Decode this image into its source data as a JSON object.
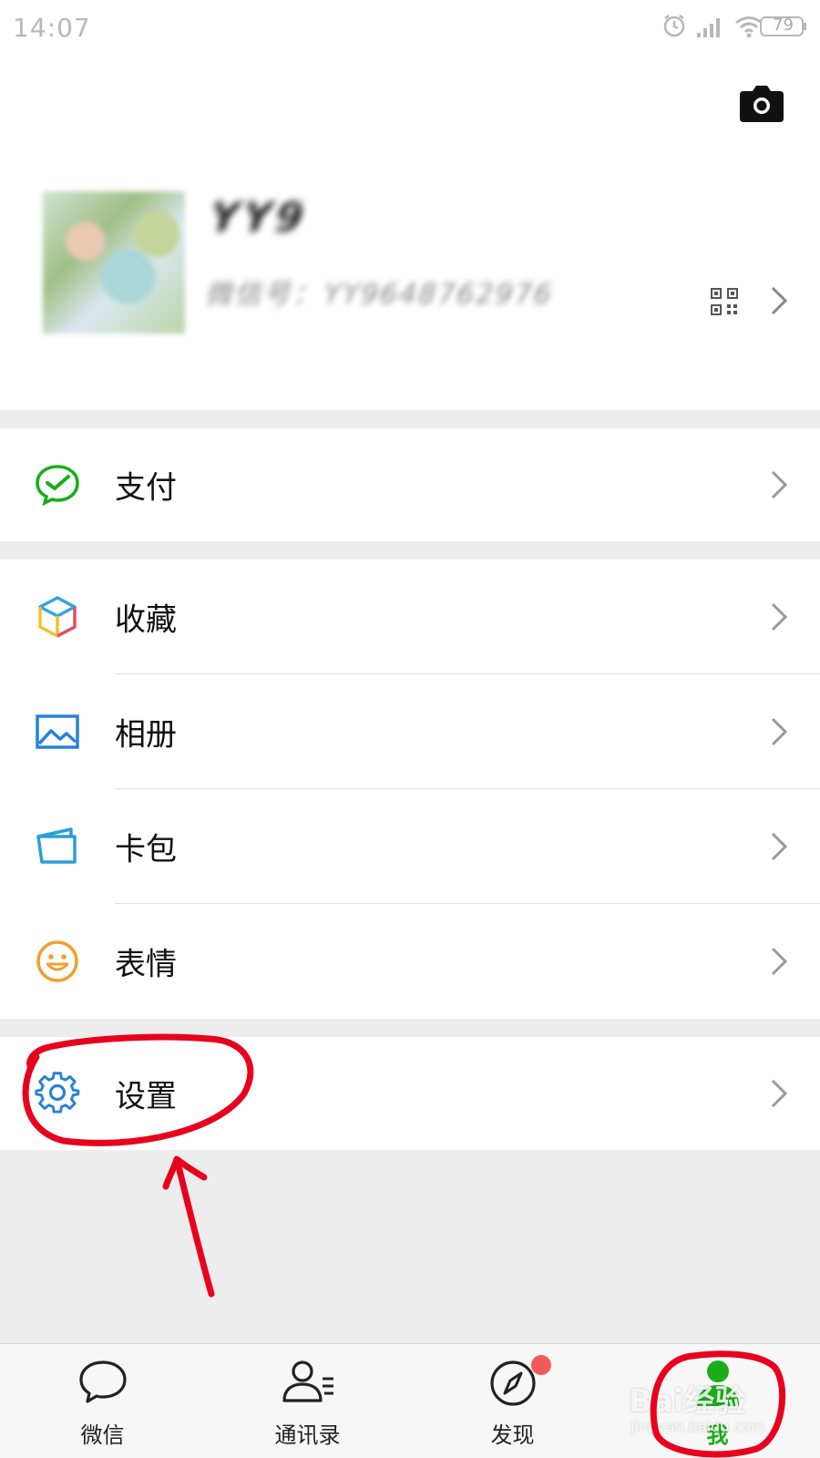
{
  "status_bar": {
    "time": "14:07",
    "battery": "79",
    "icons": [
      "alarm-icon",
      "signal-icon",
      "wifi-icon",
      "battery-icon"
    ]
  },
  "header": {
    "camera_icon": "camera-icon"
  },
  "profile": {
    "nickname": "YY9",
    "wechat_id": "微信号：YY9648762976",
    "qr_icon": "qr-code-icon"
  },
  "menu": {
    "pay": {
      "label": "支付",
      "icon": "pay-icon",
      "color": "#1aad19"
    },
    "items": [
      {
        "label": "收藏",
        "icon": "favorites-cube-icon"
      },
      {
        "label": "相册",
        "icon": "album-icon",
        "color": "#2782d7"
      },
      {
        "label": "卡包",
        "icon": "card-wallet-icon",
        "color": "#2782d7"
      },
      {
        "label": "表情",
        "icon": "sticker-smile-icon",
        "color": "#f0a030"
      }
    ],
    "settings": {
      "label": "设置",
      "icon": "gear-icon",
      "color": "#2782d7"
    }
  },
  "tabbar": {
    "tabs": [
      {
        "label": "微信",
        "icon": "chat-bubble-icon"
      },
      {
        "label": "通讯录",
        "icon": "contacts-icon"
      },
      {
        "label": "发现",
        "icon": "compass-icon",
        "badge": true
      },
      {
        "label": "我",
        "icon": "me-person-icon",
        "active": true
      }
    ],
    "active_color": "#1aad19"
  },
  "annotation": {
    "color": "#e8001c"
  },
  "watermark": {
    "text": "Bai经验",
    "sub": "jingyan.baidu.com"
  }
}
